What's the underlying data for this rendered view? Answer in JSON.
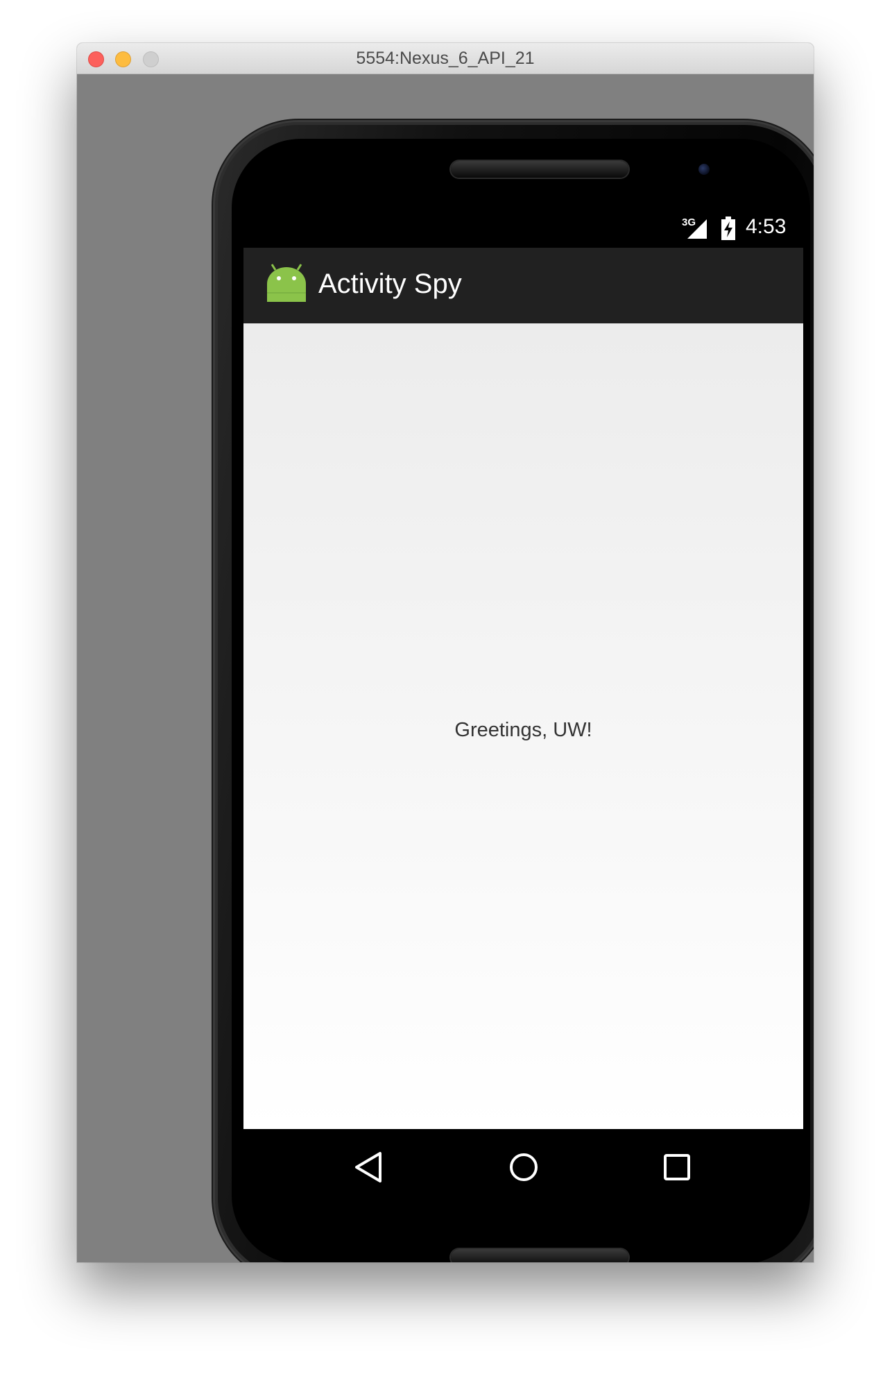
{
  "window": {
    "title": "5554:Nexus_6_API_21"
  },
  "statusbar": {
    "network": "3G",
    "time": "4:53"
  },
  "actionbar": {
    "app_title": "Activity Spy",
    "app_icon": "android-icon"
  },
  "content": {
    "greeting": "Greetings, UW!"
  },
  "navbar": {
    "back_icon": "back-triangle-icon",
    "home_icon": "home-circle-icon",
    "recents_icon": "recents-square-icon"
  },
  "colors": {
    "actionbar": "#212121",
    "android_green": "#8bc34a",
    "statusbar": "#000000"
  }
}
